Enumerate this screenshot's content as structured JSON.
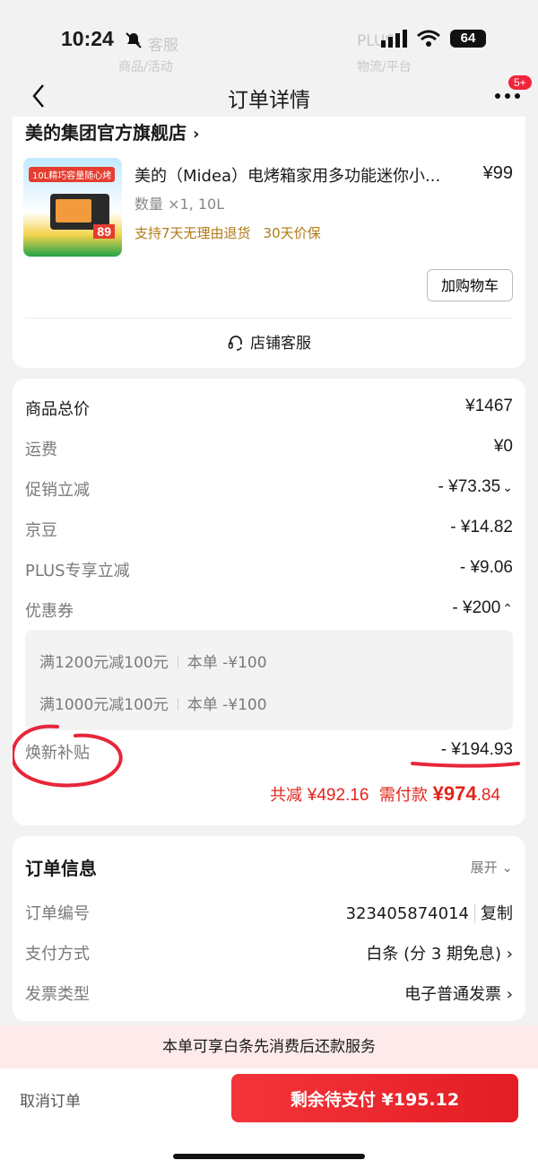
{
  "status_bar": {
    "time": "10:24",
    "battery": "64",
    "ghost_left": "客服",
    "ghost_left_sub": "商品/活动",
    "ghost_right": "PLUS",
    "ghost_right_sub": "物流/平台"
  },
  "nav": {
    "title": "订单详情",
    "badge": "5+"
  },
  "shop": {
    "name": "美的集团官方旗舰店",
    "product": {
      "name": "美的（Midea）电烤箱家用多功能迷你小...",
      "price": "¥99",
      "qty": "数量 ×1, 10L",
      "tag1": "支持7天无理由退货",
      "tag2": "30天价保",
      "thumb_tag": "10L精巧容量随心烤",
      "thumb_price": "89"
    },
    "add_cart": "加购物车",
    "service": "店铺客服"
  },
  "price": {
    "rows": [
      {
        "label": "商品总价",
        "value": "¥1467",
        "chevron": ""
      },
      {
        "label": "运费",
        "value": "¥0",
        "chevron": ""
      },
      {
        "label": "促销立减",
        "value": "- ¥73.35",
        "chevron": "⌄"
      },
      {
        "label": "京豆",
        "value": "- ¥14.82",
        "chevron": ""
      },
      {
        "label": "PLUS专享立减",
        "value": "- ¥9.06",
        "chevron": ""
      },
      {
        "label": "优惠券",
        "value": "- ¥200",
        "chevron": "⌃"
      }
    ],
    "coupons": [
      {
        "name": "满1200元减100元",
        "detail": "本单 -¥100"
      },
      {
        "name": "满1000元减100元",
        "detail": "本单 -¥100"
      }
    ],
    "subsidy_label": "焕新补贴",
    "subsidy_value": "- ¥194.93",
    "total_reduce_label": "共减",
    "total_reduce": "¥492.16",
    "need_pay_label": "需付款",
    "need_pay_int": "¥974",
    "need_pay_dec": ".84"
  },
  "order_info": {
    "title": "订单信息",
    "expand": "展开",
    "rows": [
      {
        "label": "订单编号",
        "value": "323405874014",
        "action": "复制"
      },
      {
        "label": "支付方式",
        "value": "白条 (分 3 期免息)",
        "action": "›"
      },
      {
        "label": "发票类型",
        "value": "电子普通发票",
        "action": "›"
      }
    ]
  },
  "promo": "本单可享白条先消费后还款服务",
  "bottom": {
    "cancel": "取消订单",
    "pay": "剩余待支付 ¥195.12"
  },
  "colors": {
    "accent_red": "#e1251b",
    "tag_gold": "#b07a14",
    "promo_bg": "#fdebeb"
  }
}
